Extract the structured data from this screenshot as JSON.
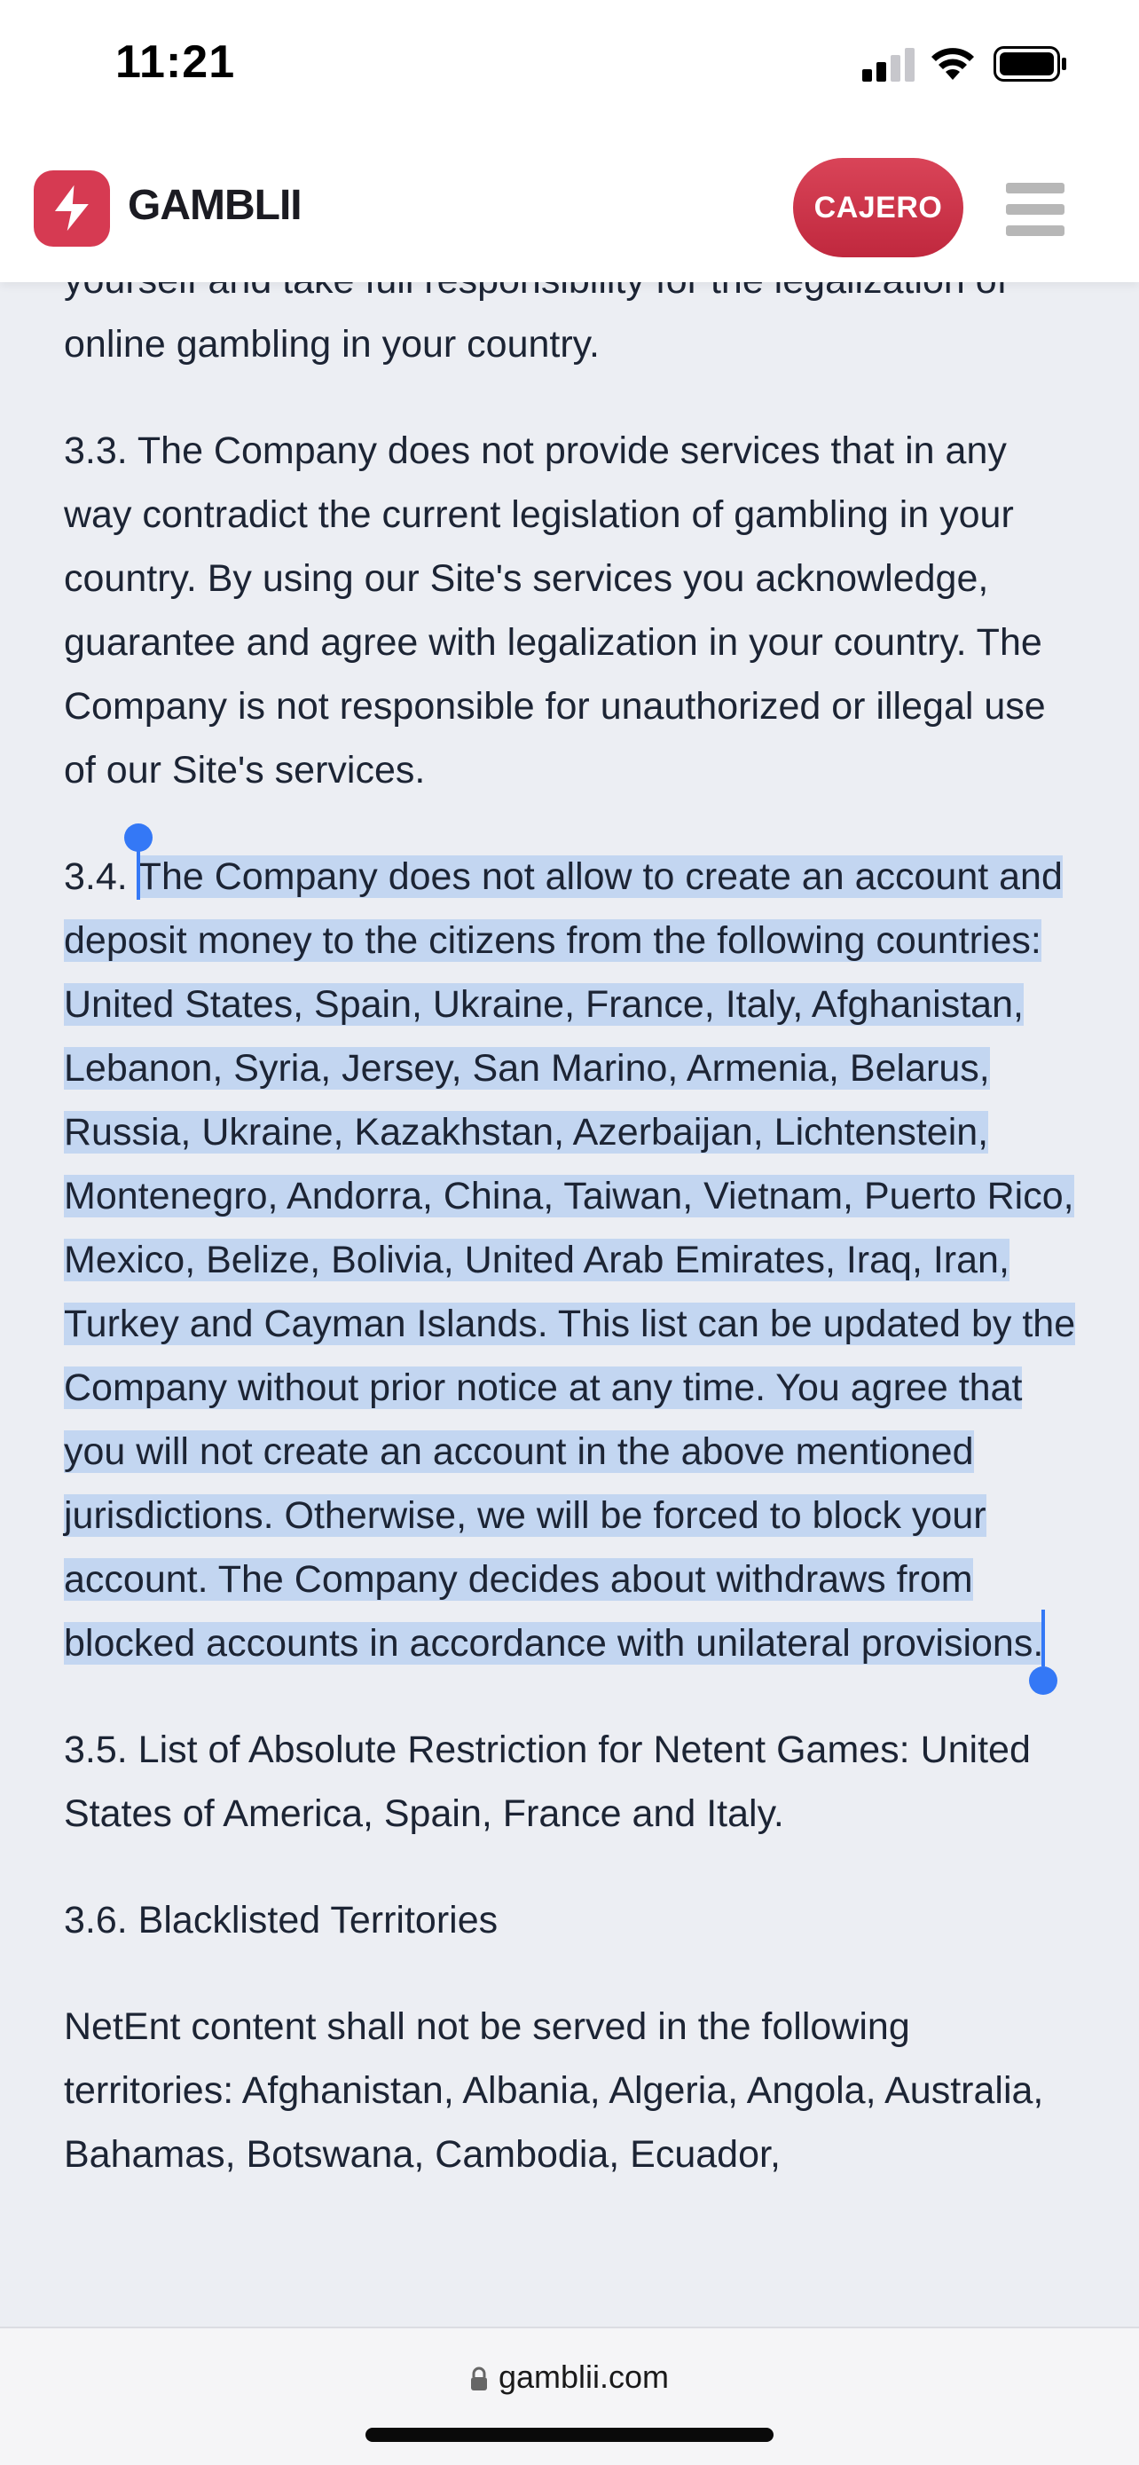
{
  "status_bar": {
    "time": "11:21"
  },
  "header": {
    "brand": "GAMBLII",
    "cashier_label": "CAJERO",
    "brand_color": "#d63a52"
  },
  "content": {
    "top_partial": "yourself and take full responsibility for the legalization of online gambling in your country.",
    "p_3_3": "3.3. The Company does not provide services that in any way contradict the current legislation of gambling in your country. By using our Site's services you acknowledge, guarantee and agree with legalization in your country. The Company is not responsible for unauthorized or illegal use of our Site's services.",
    "p_3_4_prefix": "3.4. ",
    "p_3_4_selected": "The Company does not allow to create an account and deposit money to the citizens from the following countries: United States, Spain, Ukraine, France, Italy, Afghanistan, Lebanon, Syria, Jersey, San Marino, Armenia, Belarus, Russia, Ukraine, Kazakhstan, Azerbaijan, Lichtenstein, Montenegro, Andorra, China, Taiwan, Vietnam, Puerto Rico, Mexico, Belize, Bolivia, United Arab Emirates, Iraq, Iran, Turkey and Cayman Islands. This list can be updated by the Company without prior notice at any time. You agree that you will not create an account in the above mentioned jurisdictions. Otherwise, we will be forced to block your account. The Company decides about withdraws from blocked accounts in accordance with unilateral provisions.",
    "p_3_5": "3.5. List of Absolute Restriction for Netent Games: United States of America, Spain, France and Italy.",
    "p_3_6": "3.6. Blacklisted Territories",
    "p_netent": "NetEnt content shall not be served in the following territories: Afghanistan, Albania, Algeria, Angola, Australia, Bahamas, Botswana, Cambodia, Ecuador,"
  },
  "browser": {
    "url": "gamblii.com"
  }
}
